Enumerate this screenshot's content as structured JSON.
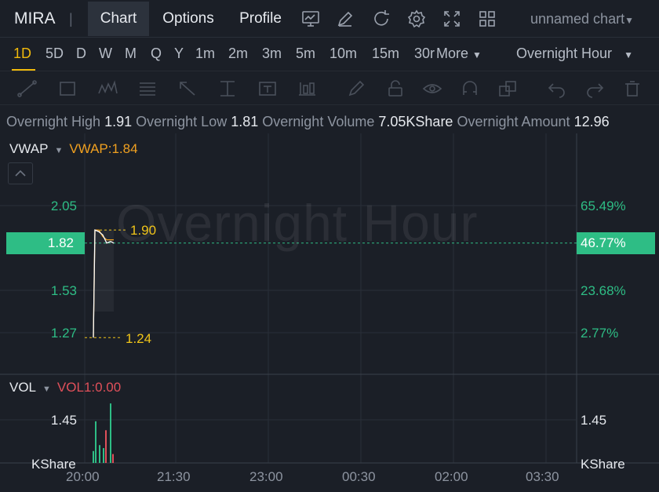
{
  "header": {
    "ticker": "MIRA",
    "separator": "|",
    "tabs": [
      {
        "label": "Chart",
        "active": true
      },
      {
        "label": "Options",
        "active": false
      },
      {
        "label": "Profile",
        "active": false
      }
    ],
    "icons": [
      "chart-board-icon",
      "edit-icon",
      "refresh-icon",
      "settings-icon",
      "fullscreen-icon",
      "layout-grid-icon"
    ],
    "chart_name": "unnamed chart"
  },
  "periods": {
    "items": [
      "1D",
      "5D",
      "D",
      "W",
      "M",
      "Q",
      "Y",
      "1m",
      "2m",
      "3m",
      "5m",
      "10m",
      "15m",
      "30r"
    ],
    "active": "1D",
    "more_label": "More",
    "session_select": "Overnight Hour"
  },
  "drawing_tools": [
    "trend-line-icon",
    "rectangle-icon",
    "pattern-icon",
    "fibonacci-icon",
    "arrow-icon",
    "price-range-icon",
    "text-note-icon",
    "long-position-icon",
    "brush-icon",
    "lock-icon",
    "eye-icon",
    "magnet-icon",
    "clone-icon",
    "undo-icon",
    "redo-icon",
    "trash-icon"
  ],
  "info": {
    "high_label": "Overnight High",
    "high_value": "1.91",
    "low_label": "Overnight Low",
    "low_value": "1.81",
    "volume_label": "Overnight Volume",
    "volume_value": "7.05KShare",
    "amount_label": "Overnight Amount",
    "amount_value": "12.96"
  },
  "main_pane": {
    "indicator": "VWAP",
    "indicator_value": "VWAP:1.84",
    "watermark": "Overnight Hour",
    "left_axis": [
      "2.05",
      "1.53",
      "1.27"
    ],
    "right_axis": [
      "65.49%",
      "23.68%",
      "2.77%"
    ],
    "current_price": "1.82",
    "current_pct": "46.77%",
    "high_marker": "1.90",
    "low_marker": "1.24"
  },
  "volume_pane": {
    "indicator": "VOL",
    "indicator_value": "VOL1:0.00",
    "left_axis": "1.45",
    "right_axis": "1.45",
    "unit_left": "KShare",
    "unit_right": "KShare"
  },
  "time_axis": [
    "20:00",
    "21:30",
    "23:00",
    "00:30",
    "02:00",
    "03:30"
  ],
  "colors": {
    "background": "#1b1f27",
    "accent": "#f0b90b",
    "up": "#2ebd85",
    "down": "#e0505a",
    "vwap": "#f0a020",
    "price_line": "#ffffff"
  },
  "chart_data": {
    "type": "line",
    "x": [
      "20:00",
      "20:05",
      "20:10",
      "20:15",
      "20:20",
      "20:25",
      "20:30"
    ],
    "series": [
      {
        "name": "VWAP",
        "values": [
          1.24,
          1.9,
          1.9,
          1.86,
          1.84,
          1.84,
          1.84
        ]
      },
      {
        "values": [
          1.24,
          1.9,
          1.89,
          1.87,
          1.82,
          1.83,
          1.82
        ]
      }
    ],
    "volume": [
      0.4,
      1.4,
      0.6,
      0.5,
      1.1,
      2.0,
      0.3
    ],
    "ylim": [
      1.15,
      2.2
    ]
  }
}
